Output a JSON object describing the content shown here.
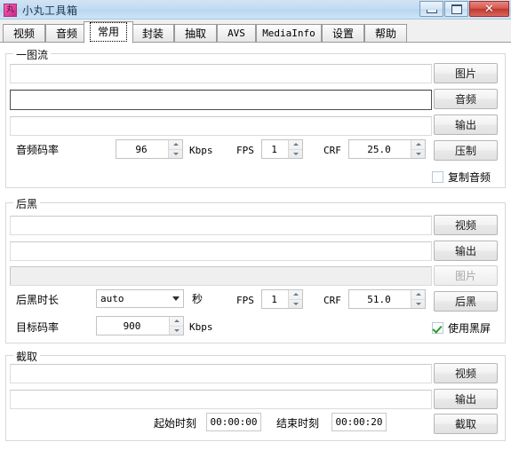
{
  "window": {
    "title": "小丸工具箱",
    "app_icon": "app-icon",
    "caption": {
      "minimize": "minimize-icon",
      "maximize": "maximize-icon",
      "close": "✕"
    }
  },
  "tabs": [
    {
      "label": "视频",
      "selected": false
    },
    {
      "label": "音频",
      "selected": false
    },
    {
      "label": "常用",
      "selected": true
    },
    {
      "label": "封装",
      "selected": false
    },
    {
      "label": "抽取",
      "selected": false
    },
    {
      "label": "AVS",
      "selected": false
    },
    {
      "label": "MediaInfo",
      "selected": false
    },
    {
      "label": "设置",
      "selected": false
    },
    {
      "label": "帮助",
      "selected": false
    }
  ],
  "groups": {
    "onepic": {
      "title": "一图流",
      "fields": {
        "image_path": "",
        "audio_path": "",
        "output_path": ""
      },
      "audio_bitrate_label": "音频码率",
      "audio_bitrate_value": "96",
      "kbps_unit": "Kbps",
      "fps_label": "FPS",
      "fps_value": "1",
      "crf_label": "CRF",
      "crf_value": "25.0",
      "buttons": {
        "image": "图片",
        "audio": "音频",
        "output": "输出",
        "encode": "压制"
      },
      "copy_audio_label": "复制音频",
      "copy_audio_checked": false
    },
    "blackend": {
      "title": "后黑",
      "fields": {
        "video_path": "",
        "output_path": "",
        "image_path": ""
      },
      "duration_label": "后黑时长",
      "duration_value": "auto",
      "seconds_unit": "秒",
      "fps_label": "FPS",
      "fps_value": "1",
      "crf_label": "CRF",
      "crf_value": "51.0",
      "bitrate_label": "目标码率",
      "bitrate_value": "900",
      "kbps_unit": "Kbps",
      "buttons": {
        "video": "视频",
        "output": "输出",
        "image": "图片",
        "run": "后黑"
      },
      "use_black_label": "使用黑屏",
      "use_black_checked": true
    },
    "clip": {
      "title": "截取",
      "fields": {
        "video_path": "",
        "output_path": ""
      },
      "start_label": "起始时刻",
      "start_value": "00:00:00",
      "end_label": "结束时刻",
      "end_value": "00:00:20",
      "buttons": {
        "video": "视频",
        "output": "输出",
        "run": "截取"
      }
    }
  },
  "colors": {
    "title_bar": "#c3dcf2",
    "close_button": "#c0392f",
    "app_icon": "#e0419c",
    "check_green": "#2c9b2c",
    "client_bg": "#ffffff"
  }
}
